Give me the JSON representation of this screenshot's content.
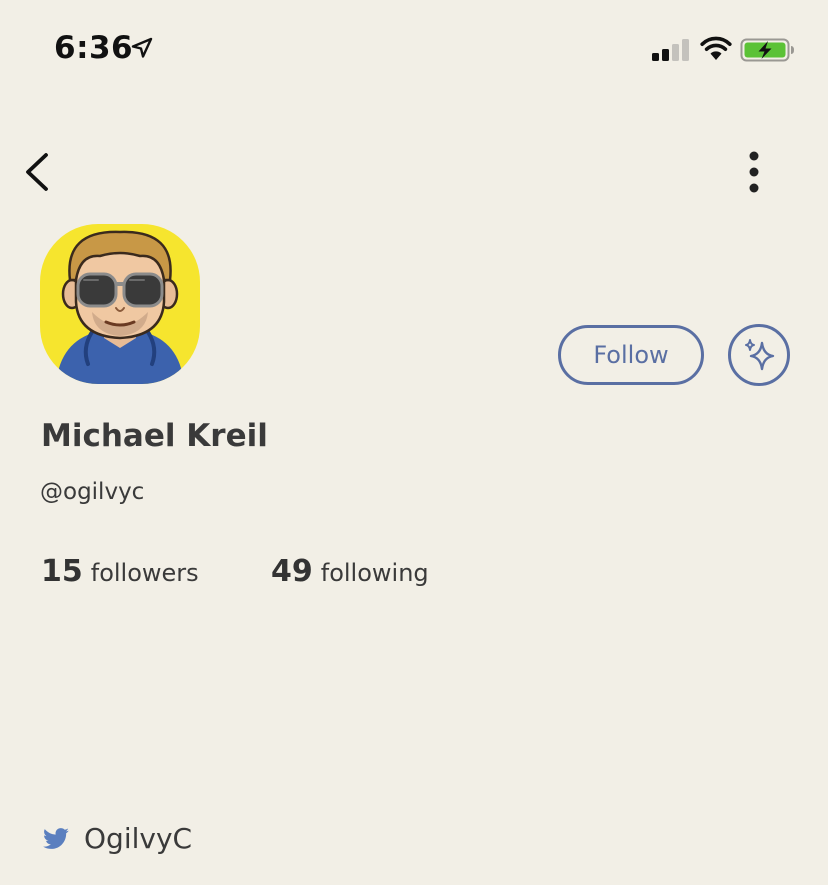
{
  "status_bar": {
    "time": "6:36",
    "icons": [
      "location-arrow-icon",
      "cellular-signal-icon",
      "wifi-icon",
      "battery-charging-icon"
    ],
    "battery_color": "#5bc236"
  },
  "nav": {
    "back_icon": "chevron-left-icon",
    "more_icon": "vertical-ellipsis-icon"
  },
  "profile": {
    "name": "Michael Kreil",
    "handle": "@ogilvyc",
    "avatar_background": "#f6e52e",
    "follow_label": "Follow",
    "sparkle_icon": "sparkles-icon",
    "followers_count": "15",
    "followers_label": "followers",
    "following_count": "49",
    "following_label": "following"
  },
  "twitter": {
    "icon": "twitter-bird-icon",
    "handle": "OgilvyC",
    "color": "#5b7fbf"
  },
  "colors": {
    "background": "#f2efe6",
    "accent": "#5a6fa3",
    "text": "#3a3a3a"
  }
}
